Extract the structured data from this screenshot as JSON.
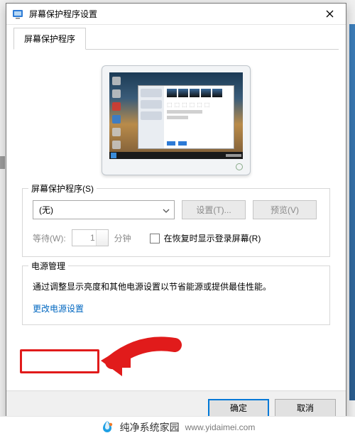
{
  "titlebar": {
    "title": "屏幕保护程序设置"
  },
  "tabs": {
    "active": "屏幕保护程序"
  },
  "groups": {
    "saver": {
      "legend": "屏幕保护程序(S)",
      "selected": "(无)",
      "settings_btn": "设置(T)...",
      "preview_btn": "预览(V)",
      "wait_label": "等待(W):",
      "wait_value": "1",
      "minutes_label": "分钟",
      "resume_checkbox": "在恢复时显示登录屏幕(R)"
    },
    "power": {
      "legend": "电源管理",
      "desc": "通过调整显示亮度和其他电源设置以节省能源或提供最佳性能。",
      "link": "更改电源设置"
    }
  },
  "footer": {
    "ok": "确定",
    "cancel": "取消"
  },
  "watermark": {
    "brand": "纯净系统家园",
    "url": "www.yidaimei.com"
  }
}
